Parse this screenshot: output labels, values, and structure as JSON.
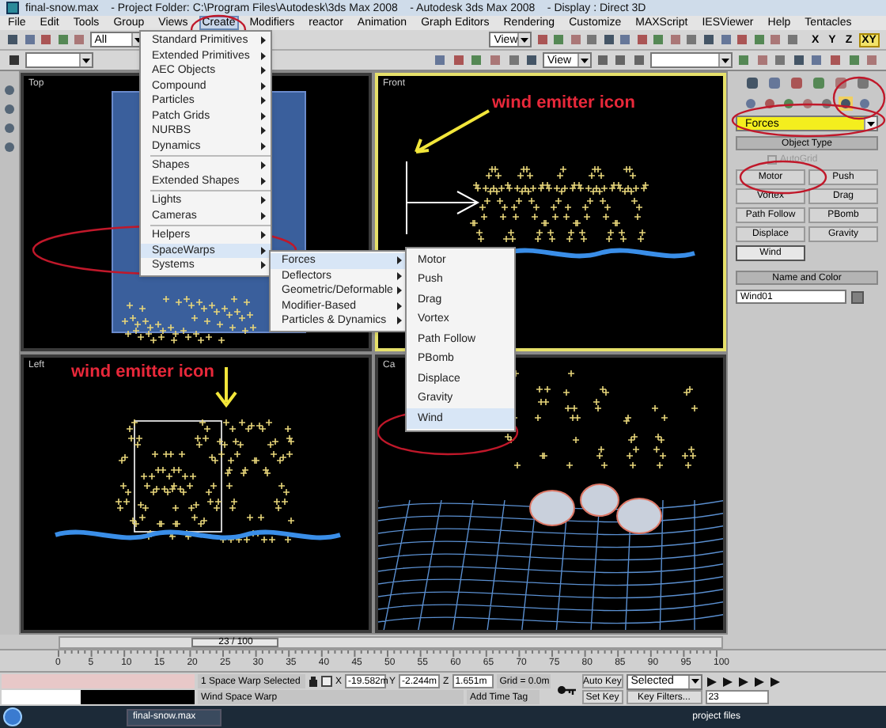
{
  "window": {
    "title": "final-snow.max    - Project Folder: C:\\Program Files\\Autodesk\\3ds Max 2008    - Autodesk 3ds Max 2008    - Display : Direct 3D"
  },
  "menu_bar": [
    {
      "label": "File",
      "selected": false
    },
    {
      "label": "Edit",
      "selected": false
    },
    {
      "label": "Tools",
      "selected": false
    },
    {
      "label": "Group",
      "selected": false
    },
    {
      "label": "Views",
      "selected": false
    },
    {
      "label": "Create",
      "selected": true
    },
    {
      "label": "Modifiers",
      "selected": false
    },
    {
      "label": "reactor",
      "selected": false
    },
    {
      "label": "Animation",
      "selected": false
    },
    {
      "label": "Graph Editors",
      "selected": false
    },
    {
      "label": "Rendering",
      "selected": false
    },
    {
      "label": "Customize",
      "selected": false
    },
    {
      "label": "MAXScript",
      "selected": false
    },
    {
      "label": "IESViewer",
      "selected": false
    },
    {
      "label": "Help",
      "selected": false
    },
    {
      "label": "Tentacles",
      "selected": false
    }
  ],
  "toolbar": {
    "selection_filter": "All",
    "reference_coord": "View",
    "reference_coord_2": "View",
    "axis_buttons": [
      {
        "label": "X",
        "selected": false
      },
      {
        "label": "Y",
        "selected": false
      },
      {
        "label": "Z",
        "selected": false
      },
      {
        "label": "XY",
        "selected": true
      }
    ]
  },
  "create_menu": [
    {
      "label": "Standard Primitives",
      "selected": false,
      "separator_before": false
    },
    {
      "label": "Extended Primitives",
      "selected": false,
      "separator_before": false
    },
    {
      "label": "AEC Objects",
      "selected": false,
      "separator_before": false
    },
    {
      "label": "Compound",
      "selected": false,
      "separator_before": false
    },
    {
      "label": "Particles",
      "selected": false,
      "separator_before": false
    },
    {
      "label": "Patch Grids",
      "selected": false,
      "separator_before": false
    },
    {
      "label": "NURBS",
      "selected": false,
      "separator_before": false
    },
    {
      "label": "Dynamics",
      "selected": false,
      "separator_before": false
    },
    {
      "label": "Shapes",
      "selected": false,
      "separator_before": true
    },
    {
      "label": "Extended Shapes",
      "selected": false,
      "separator_before": false
    },
    {
      "label": "Lights",
      "selected": false,
      "separator_before": true
    },
    {
      "label": "Cameras",
      "selected": false,
      "separator_before": false
    },
    {
      "label": "Helpers",
      "selected": false,
      "separator_before": true
    },
    {
      "label": "SpaceWarps",
      "selected": true,
      "separator_before": false
    },
    {
      "label": "Systems",
      "selected": false,
      "separator_before": false
    }
  ],
  "spacewarps_submenu": [
    {
      "label": "Forces",
      "selected": true
    },
    {
      "label": "Deflectors",
      "selected": false
    },
    {
      "label": "Geometric/Deformable",
      "selected": false
    },
    {
      "label": "Modifier-Based",
      "selected": false
    },
    {
      "label": "Particles & Dynamics",
      "selected": false
    }
  ],
  "forces_submenu": [
    {
      "label": "Motor",
      "selected": false
    },
    {
      "label": "Push",
      "selected": false
    },
    {
      "label": "Drag",
      "selected": false
    },
    {
      "label": "Vortex",
      "selected": false
    },
    {
      "label": "Path Follow",
      "selected": false
    },
    {
      "label": "PBomb",
      "selected": false
    },
    {
      "label": "Displace",
      "selected": false
    },
    {
      "label": "Gravity",
      "selected": false
    },
    {
      "label": "Wind",
      "selected": true
    }
  ],
  "viewports": [
    {
      "label": "Top",
      "active": false,
      "kind": "top"
    },
    {
      "label": "Front",
      "active": true,
      "kind": "front",
      "annotation": "wind emitter icon"
    },
    {
      "label": "Left",
      "active": false,
      "kind": "left",
      "annotation": "wind emitter icon"
    },
    {
      "label": "Ca",
      "active": false,
      "kind": "perspective"
    }
  ],
  "command_panel": {
    "category": "Forces",
    "object_type_title": "Object Type",
    "autogrid": {
      "label": "AutoGrid",
      "checked": false,
      "disabled": true
    },
    "buttons": [
      {
        "label": "Motor",
        "selected": false
      },
      {
        "label": "Push",
        "selected": false
      },
      {
        "label": "Vortex",
        "selected": false
      },
      {
        "label": "Drag",
        "selected": false
      },
      {
        "label": "Path Follow",
        "selected": false
      },
      {
        "label": "PBomb",
        "selected": false
      },
      {
        "label": "Displace",
        "selected": false
      },
      {
        "label": "Gravity",
        "selected": false
      },
      {
        "label": "Wind",
        "selected": true
      }
    ],
    "name_color_title": "Name and Color",
    "name": "Wind01"
  },
  "time_slider": {
    "label": "23 / 100",
    "level": 0.23
  },
  "track_ticks": [
    "0",
    "5",
    "10",
    "15",
    "20",
    "25",
    "30",
    "35",
    "40",
    "45",
    "50",
    "55",
    "60",
    "65",
    "70",
    "75",
    "80",
    "85",
    "90",
    "95",
    "100"
  ],
  "status": {
    "selection": "1 Space Warp Selected",
    "prompt": "Wind Space Warp",
    "coords": [
      {
        "label": "X",
        "value": "-19.582m"
      },
      {
        "label": "Y",
        "value": "-2.244m"
      },
      {
        "label": "Z",
        "value": "1.651m"
      }
    ],
    "grid": "Grid = 0.0m",
    "time_tag": "Add Time Tag"
  },
  "animation": {
    "auto_key": "Auto Key",
    "set_key": "Set Key",
    "key_mode": "Selected",
    "key_filters": "Key Filters...",
    "frame": "23"
  },
  "taskbar": {
    "tasks": [
      {
        "label": "final-snow.max",
        "selected": true
      }
    ],
    "tray": "project files"
  }
}
